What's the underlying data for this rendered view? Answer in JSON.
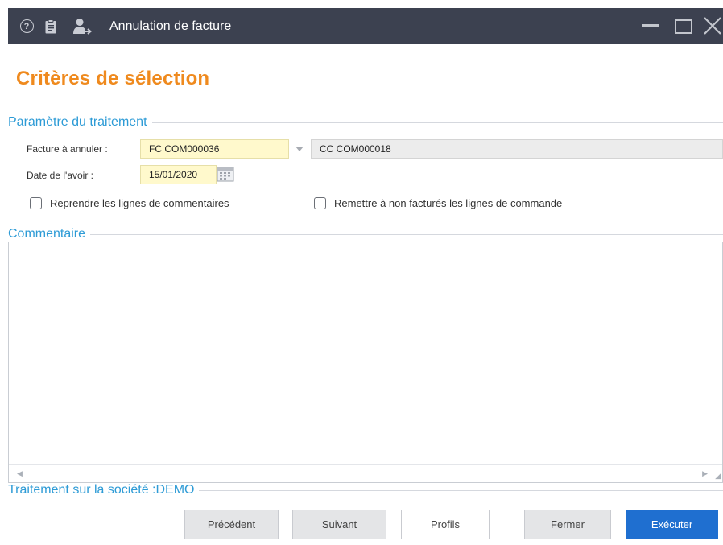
{
  "window": {
    "title": "Annulation de facture",
    "help_glyph": "?",
    "icons": [
      "help-icon",
      "clipboard-icon",
      "user-icon",
      "minimize-icon",
      "maximize-icon",
      "close-icon"
    ]
  },
  "page": {
    "title": "Critères de sélection"
  },
  "params_section": {
    "title": "Paramètre du traitement",
    "invoice_label": "Facture à annuler :",
    "invoice_value": "FC COM000036",
    "order_value": "CC COM000018",
    "date_label": "Date de l'avoir :",
    "date_value": "15/01/2020",
    "checkbox_comments": {
      "label": "Reprendre les lignes de commentaires",
      "checked": false
    },
    "checkbox_uninvoice": {
      "label": "Remettre à non facturés les lignes de commande",
      "checked": false
    }
  },
  "comment_section": {
    "title": "Commentaire",
    "value": ""
  },
  "company_section": {
    "title": "Traitement sur la société :DEMO"
  },
  "buttons": {
    "previous": "Précédent",
    "next": "Suivant",
    "profiles": "Profils",
    "close": "Fermer",
    "execute": "Exécuter"
  },
  "colors": {
    "titlebar": "#3c4150",
    "heading": "#ef8a1e",
    "section": "#2d9bd6",
    "primary_button": "#1f6fd0",
    "input_highlight": "#fff9cc"
  }
}
